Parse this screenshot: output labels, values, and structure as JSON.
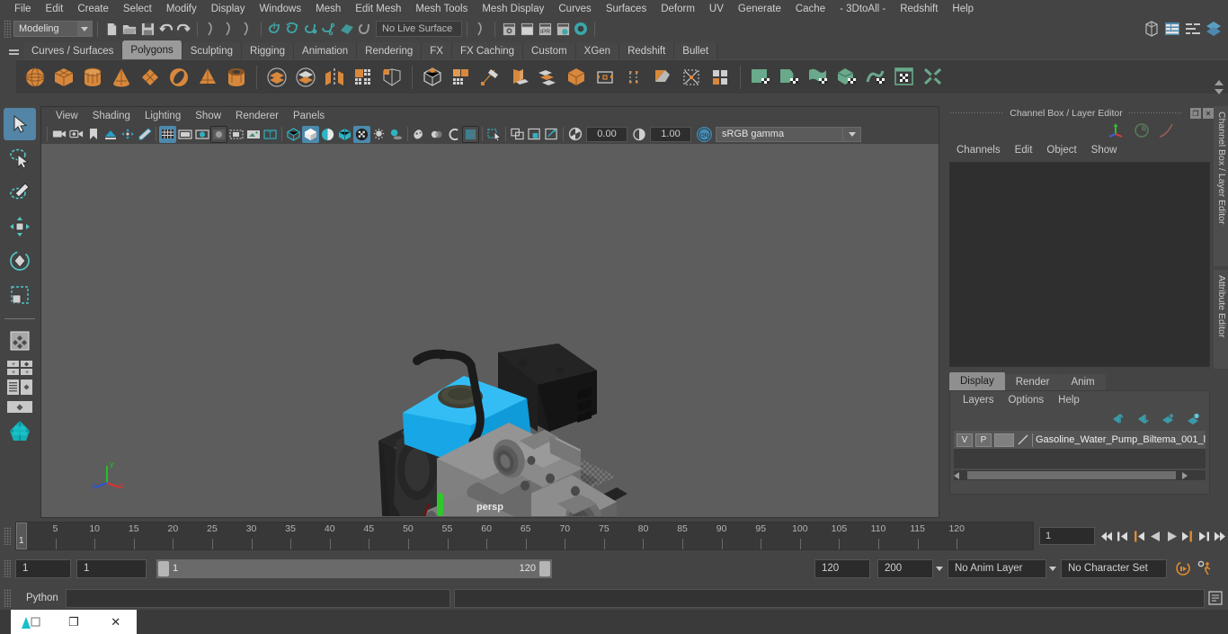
{
  "menubar": {
    "items": [
      "File",
      "Edit",
      "Create",
      "Select",
      "Modify",
      "Display",
      "Windows",
      "Mesh",
      "Edit Mesh",
      "Mesh Tools",
      "Mesh Display",
      "Curves",
      "Surfaces",
      "Deform",
      "UV",
      "Generate",
      "Cache",
      "- 3DtoAll -",
      "Redshift",
      "Help"
    ]
  },
  "statusline": {
    "mode": "Modeling",
    "live_surface": "No Live Surface",
    "icons": [
      "new-scene-icon",
      "open-scene-icon",
      "save-scene-icon",
      "undo-icon",
      "redo-icon",
      "select-by-hierarchy-icon",
      "select-by-object-icon",
      "select-by-component-icon",
      "snap-to-grid-icon",
      "snap-to-curve-icon",
      "snap-to-point-icon",
      "snap-to-projected-center-icon",
      "snap-to-view-plane-icon",
      "make-live-icon",
      "render-current-frame-icon",
      "ipr-render-icon",
      "render-settings-icon",
      "hypershade-icon",
      "open-render-view-icon",
      "toggle-sidebar-icon",
      "attribute-editor-icon",
      "tool-settings-icon",
      "channel-box-icon"
    ]
  },
  "shelf": {
    "tabs": [
      "Curves / Surfaces",
      "Polygons",
      "Sculpting",
      "Rigging",
      "Animation",
      "Rendering",
      "FX",
      "FX Caching",
      "Custom",
      "XGen",
      "Redshift",
      "Bullet"
    ],
    "active_tab": "Polygons",
    "icons": [
      "poly-sphere-icon",
      "poly-cube-icon",
      "poly-cylinder-icon",
      "poly-cone-icon",
      "poly-plane-icon",
      "poly-torus-icon",
      "poly-pyramid-icon",
      "poly-pipe-icon",
      "poly-booleans-union-icon",
      "poly-booleans-difference-icon",
      "poly-mirror-icon",
      "poly-combine-icon",
      "poly-separate-icon",
      "poly-smooth-icon",
      "poly-extrude-icon",
      "poly-create-tool-icon",
      "poly-bevel-icon",
      "poly-bridge-icon",
      "poly-chamfer-icon",
      "poly-append-icon",
      "poly-multicut-icon",
      "poly-target-weld-icon",
      "poly-quad-draw-icon",
      "sculpt-plane-icon",
      "sculpt-curve-icon",
      "sculpt-surface-icon",
      "sculpt-mesh-icon",
      "sculpt-deform-icon",
      "uv-editor-icon",
      "uv-unfold-icon"
    ]
  },
  "viewport": {
    "menus": [
      "View",
      "Shading",
      "Lighting",
      "Show",
      "Renderer",
      "Panels"
    ],
    "exposure": "0.00",
    "gamma": "1.00",
    "color_space": "sRGB gamma",
    "camera_label": "persp",
    "axis_x": "x",
    "axis_y": "y",
    "axis_z": "z"
  },
  "channelbox": {
    "title": "Channel Box / Layer Editor",
    "menus": [
      "Channels",
      "Edit",
      "Object",
      "Show"
    ],
    "restore_icon": "restore-window-icon",
    "close_icon": "close-icon"
  },
  "layereditor": {
    "tabs": [
      "Display",
      "Render",
      "Anim"
    ],
    "active_tab": "Display",
    "menus": [
      "Layers",
      "Options",
      "Help"
    ],
    "buttons": [
      "move-layer-up-icon",
      "move-layer-down-icon",
      "create-new-layer-icon",
      "create-layer-from-selected-icon"
    ],
    "rows": [
      {
        "visibility": "V",
        "playback": "P",
        "name": "Gasoline_Water_Pump_Biltema_001_l"
      }
    ]
  },
  "sidetabs": [
    "Channel Box / Layer Editor",
    "Attribute Editor"
  ],
  "timeslider": {
    "ticks": [
      5,
      10,
      15,
      20,
      25,
      30,
      35,
      40,
      45,
      50,
      55,
      60,
      65,
      70,
      75,
      80,
      85,
      90,
      95,
      100,
      105,
      110,
      115,
      120
    ],
    "current_frame": "1",
    "frame_field": "1",
    "playback_buttons": [
      "go-to-start-icon",
      "step-back-keyframe-icon",
      "step-back-frame-icon",
      "play-backwards-icon",
      "play-forwards-icon",
      "step-forward-frame-icon",
      "step-forward-keyframe-icon",
      "go-to-end-icon"
    ]
  },
  "rangeslider": {
    "anim_start": "1",
    "range_start": "1",
    "bar_start_label": "1",
    "bar_end_label": "120",
    "range_end": "120",
    "anim_end": "200",
    "anim_layer": "No Anim Layer",
    "character_set": "No Character Set",
    "auto_key_icon": "auto-keyframe-icon",
    "anim_prefs_icon": "animation-preferences-icon"
  },
  "commandline": {
    "language": "Python",
    "command_value": "",
    "result_value": "",
    "script_editor_icon": "script-editor-icon"
  },
  "taskbar": {
    "app_icon": "maya-app-icon",
    "restore_label": "❐",
    "close_label": "✕"
  },
  "colors": {
    "accent_blue": "#4d89ad",
    "shelf_orange": "#d8883c",
    "shelf_green": "#6aa98b",
    "panel_bg": "#444444",
    "viewport_bg": "#5d5d5d"
  }
}
